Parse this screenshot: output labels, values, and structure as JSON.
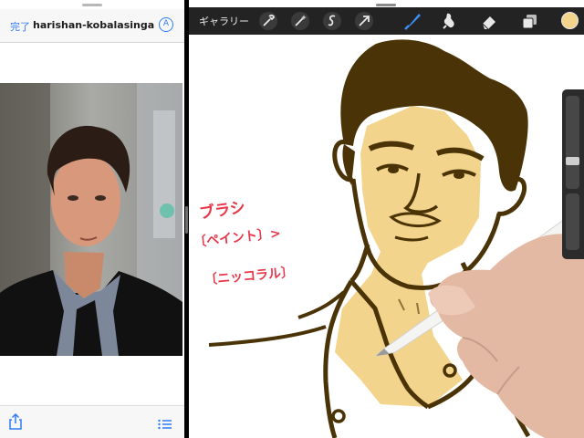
{
  "safari": {
    "done_label": "完了",
    "url": "harishan-kobalasingam-...",
    "reader_icon": "A",
    "share_icon": "share-icon",
    "list_icon": "list-icon"
  },
  "procreate": {
    "gallery_label": "ギャラリー",
    "tools": [
      "wrench-icon",
      "magic-wand-icon",
      "selection-icon",
      "transform-arrow-icon",
      "brush-icon",
      "smudge-icon",
      "eraser-icon",
      "layers-icon"
    ],
    "active_tool": "brush-icon",
    "current_color": "#f3d48c",
    "brush_size_level": 0.72
  },
  "annotation": {
    "line1": "ブラシ",
    "line2": "〔ペイント〕>",
    "line3": "〔ニッコラル〕",
    "color": "#e8364a"
  }
}
